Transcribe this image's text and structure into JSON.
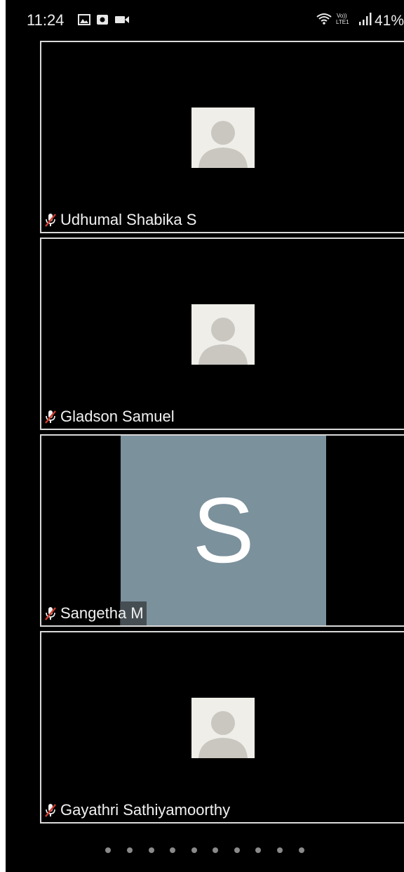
{
  "status_bar": {
    "time": "11:24",
    "left_icons": [
      "gallery-icon",
      "screen-record-icon",
      "video-camera-icon"
    ],
    "right_icons": [
      "wifi-icon",
      "volte-lte-icon",
      "signal-icon"
    ],
    "network_label": "Vo)) LTE1",
    "battery": "41%"
  },
  "participants": [
    {
      "name": "Udhumal Shabika S",
      "avatar_type": "default-avatar",
      "muted": true
    },
    {
      "name": "Gladson Samuel",
      "avatar_type": "default-avatar",
      "muted": true
    },
    {
      "name": "Sangetha M",
      "avatar_type": "letter-avatar",
      "avatar_letter": "S",
      "avatar_color": "#7b919c",
      "muted": true
    },
    {
      "name": "Gayathri Sathiyamoorthy",
      "avatar_type": "default-avatar",
      "muted": true
    }
  ],
  "pagination": {
    "total_pages": 10,
    "current_page": 1
  },
  "colors": {
    "background": "#000000",
    "tile_border": "#d9d9d9",
    "default_avatar_bg": "#efeee8",
    "default_avatar_figure": "#c9c7c0",
    "mute_icon_red": "#d23a2c"
  }
}
